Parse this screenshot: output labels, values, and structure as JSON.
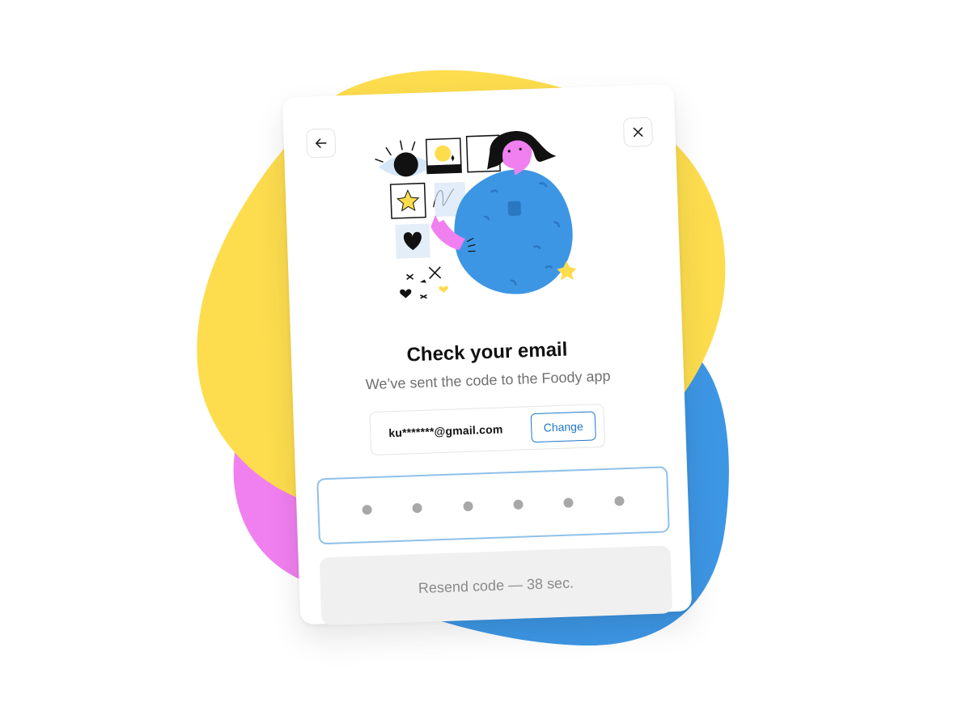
{
  "dialog": {
    "title": "Check your email",
    "subtitle": "We’ve sent the code to the Foody app",
    "email": "ku*******@gmail.com",
    "change_label": "Change",
    "code_length": 6,
    "resend_label": "Resend code — 38 sec."
  },
  "icons": {
    "back": "arrow-left-icon",
    "close": "close-icon",
    "illustration": "woman-with-photos-illustration"
  },
  "colors": {
    "blob_yellow": "#FDDD4E",
    "blob_blue": "#3D96E4",
    "blob_pink": "#F07FF0",
    "accent": "#1E78C8",
    "input_border": "#8FC1EA",
    "resend_bg": "#F0F0F0"
  }
}
